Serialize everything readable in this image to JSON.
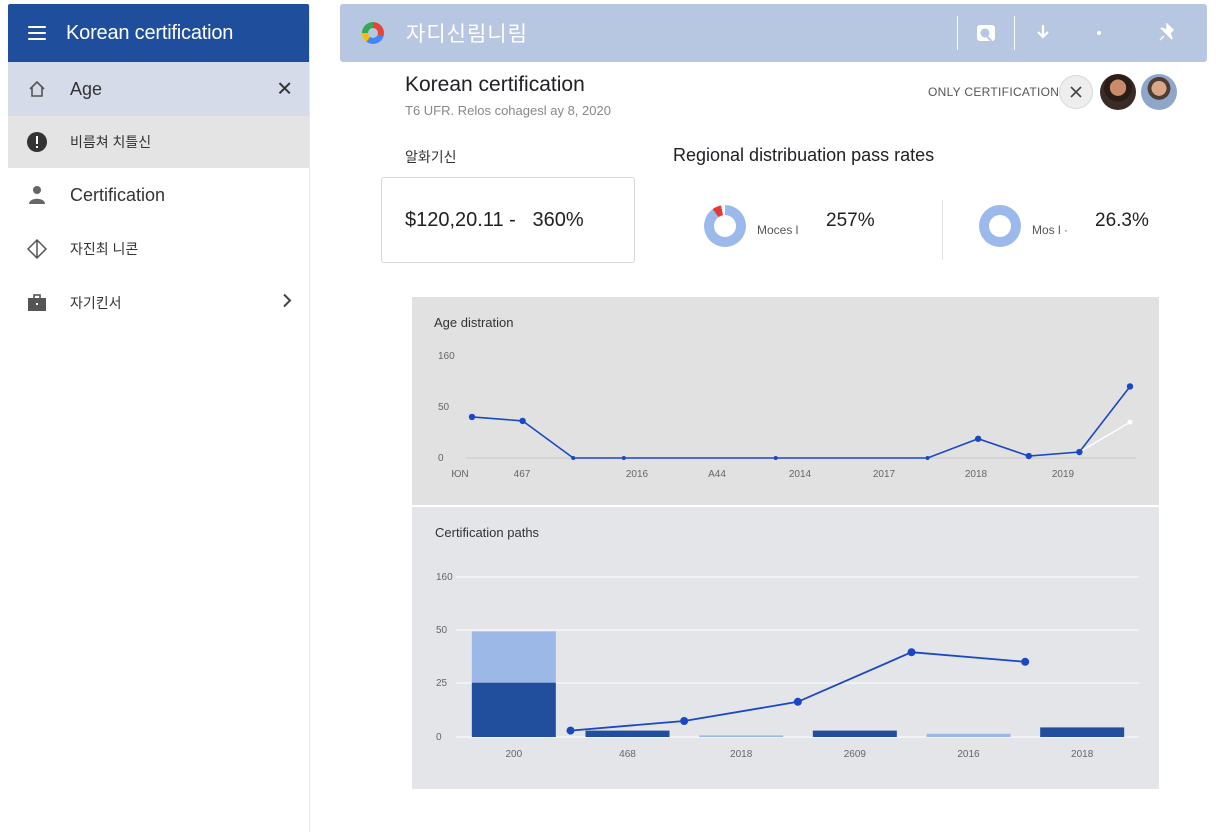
{
  "sidebar": {
    "title": "Korean certification",
    "items": [
      {
        "label": "Age",
        "icon": "home-icon"
      },
      {
        "label": "비름쳐 치틀신",
        "icon": "alert-circle-icon"
      },
      {
        "label": "Certification",
        "icon": "person-icon"
      },
      {
        "label": "자진최 니콘",
        "icon": "diamond-icon"
      },
      {
        "label": "자기킨서",
        "icon": "briefcase-icon"
      }
    ]
  },
  "topbar": {
    "title": "자디신림니림",
    "icons": [
      "search-icon",
      "download-icon",
      "dot-icon",
      "pin-icon"
    ]
  },
  "header": {
    "title": "Korean certification",
    "subtitle": "T6 UFR. Relos cohagesl ay 8, 2020",
    "filter_label": "ONLY CERTIFICATION"
  },
  "kpi": {
    "label": "알화기신",
    "value": "$120,20.11 -   360%"
  },
  "regional": {
    "title": "Regional distribuation pass rates",
    "items": [
      {
        "label": "Moces l",
        "value": "257%"
      },
      {
        "label": "Mos l ·",
        "value": "26.3%"
      }
    ]
  },
  "colors": {
    "primary": "#1f4e9c",
    "topbar": "#b7c7e1",
    "line": "#1a47c4",
    "bar_dark": "#214f9d",
    "bar_light": "#9bb8e6"
  },
  "chart_data": [
    {
      "type": "line",
      "title": "Age distration",
      "yticks": [
        "160",
        "50",
        "0"
      ],
      "ylim": [
        0,
        160
      ],
      "xticks": [
        "ЮN",
        "467",
        "2016",
        "A44",
        "2014",
        "2017",
        "2018",
        "2019"
      ],
      "series": [
        {
          "values": [
            [
              0,
              62
            ],
            [
              1,
              56
            ],
            [
              2,
              0
            ],
            [
              3,
              0
            ],
            [
              4,
              0
            ],
            [
              5,
              0
            ],
            [
              6,
              0
            ],
            [
              7,
              0
            ],
            [
              8,
              0
            ],
            [
              9,
              0
            ],
            [
              10,
              29
            ],
            [
              11,
              3
            ],
            [
              12,
              9
            ],
            [
              13,
              108
            ]
          ]
        },
        {
          "values": [
            [
              12,
              9
            ],
            [
              13,
              54
            ]
          ]
        }
      ],
      "markers": [
        0,
        1,
        2,
        3,
        6,
        9,
        10,
        11,
        12,
        13
      ]
    },
    {
      "type": "bar",
      "title": "Certification paths",
      "yticks": [
        "160",
        "50",
        "25",
        "0"
      ],
      "ylim": [
        0,
        100
      ],
      "categories": [
        "200",
        "468",
        "2018",
        "2609",
        "2016",
        "2018"
      ],
      "series": [
        {
          "values": [
            34,
            4,
            0,
            4,
            0,
            6
          ]
        },
        {
          "values": [
            32,
            0,
            1,
            0,
            2,
            0
          ]
        }
      ],
      "line": [
        4,
        10,
        22,
        53,
        47
      ]
    }
  ]
}
